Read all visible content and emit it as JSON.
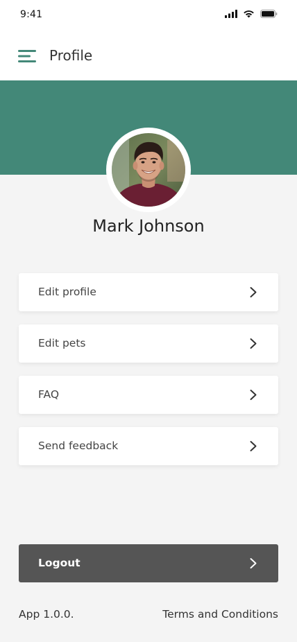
{
  "status_bar": {
    "time": "9:41",
    "icons": [
      "cellular-signal-icon",
      "wifi-icon",
      "battery-icon"
    ]
  },
  "header": {
    "title": "Profile",
    "menu_icon": "hamburger-menu-icon"
  },
  "colors": {
    "accent": "#438878",
    "background": "#f4f4f4",
    "card": "#ffffff",
    "logout_bg": "#555555"
  },
  "profile": {
    "name": "Mark Johnson"
  },
  "menu": {
    "items": [
      {
        "label": "Edit profile",
        "icon": "chevron-right-icon"
      },
      {
        "label": "Edit pets",
        "icon": "chevron-right-icon"
      },
      {
        "label": "FAQ",
        "icon": "chevron-right-icon"
      },
      {
        "label": "Send feedback",
        "icon": "chevron-right-icon"
      }
    ]
  },
  "logout": {
    "label": "Logout",
    "icon": "chevron-right-icon"
  },
  "footer": {
    "version": "App 1.0.0.",
    "terms": "Terms and Conditions"
  }
}
